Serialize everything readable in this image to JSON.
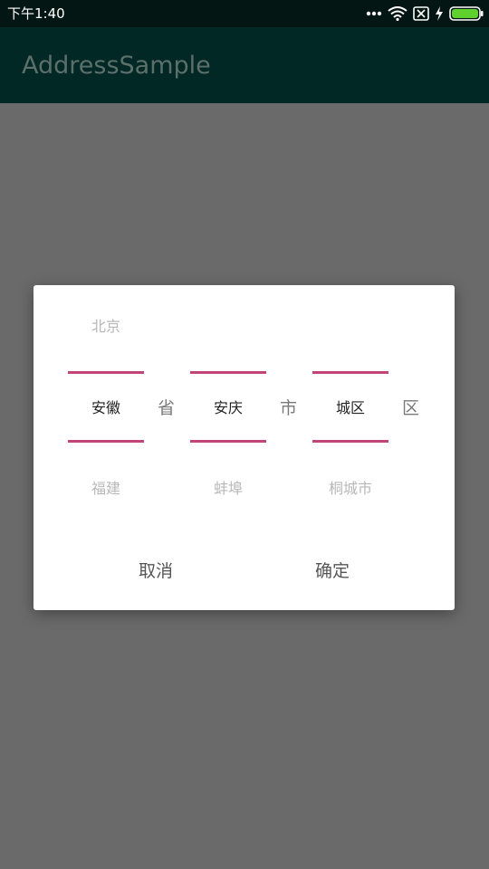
{
  "status_bar": {
    "time": "下午1:40",
    "icons": [
      "more-dots-icon",
      "wifi-icon",
      "sim-blocked-icon",
      "charging-bolt-icon",
      "battery-icon"
    ],
    "battery_color": "#5fd12e"
  },
  "app_bar": {
    "title": "AddressSample",
    "background": "#012824"
  },
  "dialog": {
    "province_picker": {
      "items": [
        "北京",
        "安徽",
        "福建"
      ],
      "selected": "安徽",
      "unit": "省"
    },
    "city_picker": {
      "items": [
        "",
        "安庆",
        "蚌埠"
      ],
      "selected": "安庆",
      "unit": "市"
    },
    "district_picker": {
      "items": [
        "",
        "城区",
        "桐城市"
      ],
      "selected": "城区",
      "unit": "区"
    },
    "divider_color": "#c2457a",
    "cancel_label": "取消",
    "confirm_label": "确定"
  }
}
